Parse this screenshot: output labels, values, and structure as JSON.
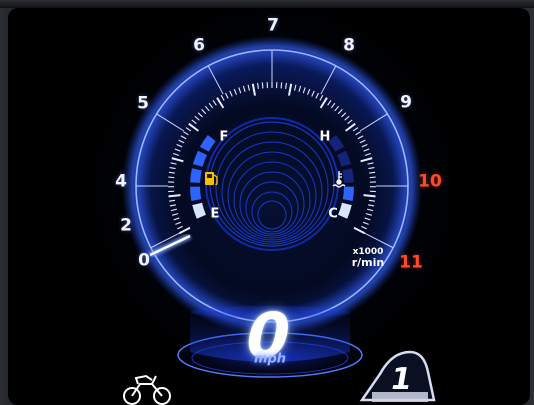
{
  "tachometer": {
    "major_labels": [
      "0",
      "2",
      "4",
      "5",
      "6",
      "7",
      "8",
      "9",
      "10",
      "11"
    ],
    "redline_labels": [
      "10",
      "11"
    ],
    "multiplier": "x1000",
    "unit": "r/min",
    "current_rpm_x1000": 0,
    "redline_color": "#ff4a2a"
  },
  "fuel_gauge": {
    "full_label": "F",
    "empty_label": "E",
    "icon": "fuel-pump-icon",
    "filled_segments": 5,
    "total_segments": 5
  },
  "temp_gauge": {
    "hot_label": "H",
    "cold_label": "C",
    "icon": "coolant-temperature-icon",
    "filled_segments": 2,
    "total_segments": 5
  },
  "speedometer": {
    "value": "0",
    "unit": "mph"
  },
  "gear_indicator": {
    "value": "1"
  },
  "riding_mode": {
    "icon": "motorcycle-icon"
  },
  "colors": {
    "accent_blue": "#2f63ff",
    "glow_blue": "#4a78ff",
    "segment_light": "#d6e4ff",
    "background": "#000000"
  }
}
